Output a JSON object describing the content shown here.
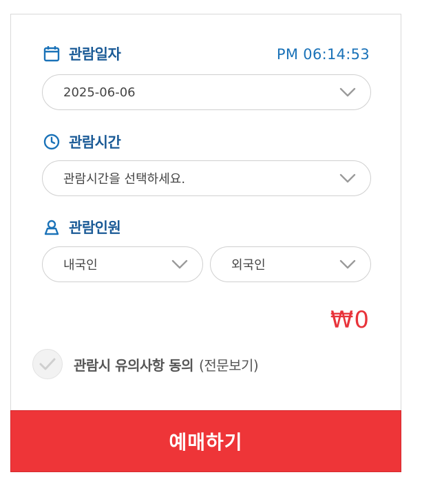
{
  "date_section": {
    "label": "관람일자",
    "icon": "calendar-icon",
    "clock": "PM 06:14:53",
    "selected_value": "2025-06-06"
  },
  "time_section": {
    "label": "관람시간",
    "icon": "clock-icon",
    "placeholder": "관람시간을 선택하세요."
  },
  "people_section": {
    "label": "관람인원",
    "icon": "person-icon",
    "domestic": "내국인",
    "foreign": "외국인"
  },
  "price": "₩0",
  "agreement": {
    "label": "관람시 유의사항 동의",
    "link": "(전문보기)",
    "checked": false
  },
  "book_button": "예매하기",
  "colors": {
    "accent_blue": "#1a5a96",
    "time_blue": "#1a72b8",
    "price_red": "#e8333a",
    "button_red": "#ee3538"
  }
}
